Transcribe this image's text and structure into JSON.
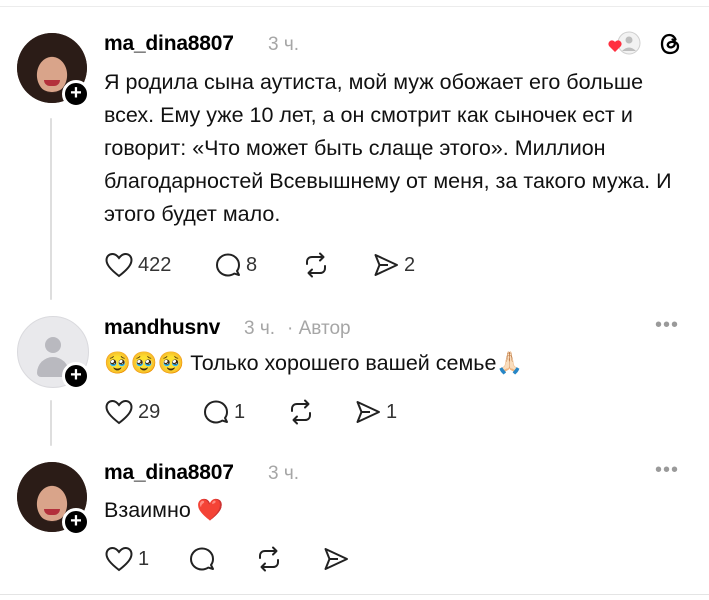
{
  "comments": [
    {
      "username": "ma_dina8807",
      "time": "3 ч.",
      "text": "Я родила сына аутиста, мой муж обожает его больше всех. Ему уже 10 лет, а он смотрит как сыночек ест и говорит: «Что может быть слаще этого». Миллион благодарностей Всевышнему от меня, за такого мужа. И этого будет мало.",
      "likes": "422",
      "replies": "8",
      "shares": "2"
    },
    {
      "username": "mandhusnv",
      "time": "3 ч.",
      "author_tag": "· Автор",
      "text": "🥹🥹🥹 Только хорошего вашей семье🙏🏻",
      "likes": "29",
      "replies": "1",
      "shares": "1"
    },
    {
      "username": "ma_dina8807",
      "time": "3 ч.",
      "text": "Взаимно ❤️",
      "likes": "1",
      "replies": "",
      "shares": ""
    }
  ],
  "icons": [
    "threads-logo-icon",
    "liked-reaction-icon",
    "heart-icon",
    "reply-icon",
    "repost-icon",
    "share-icon",
    "more-icon"
  ],
  "colors": {
    "liked_heart": "#ff3040",
    "meta_gray": "#a6a6a6"
  }
}
